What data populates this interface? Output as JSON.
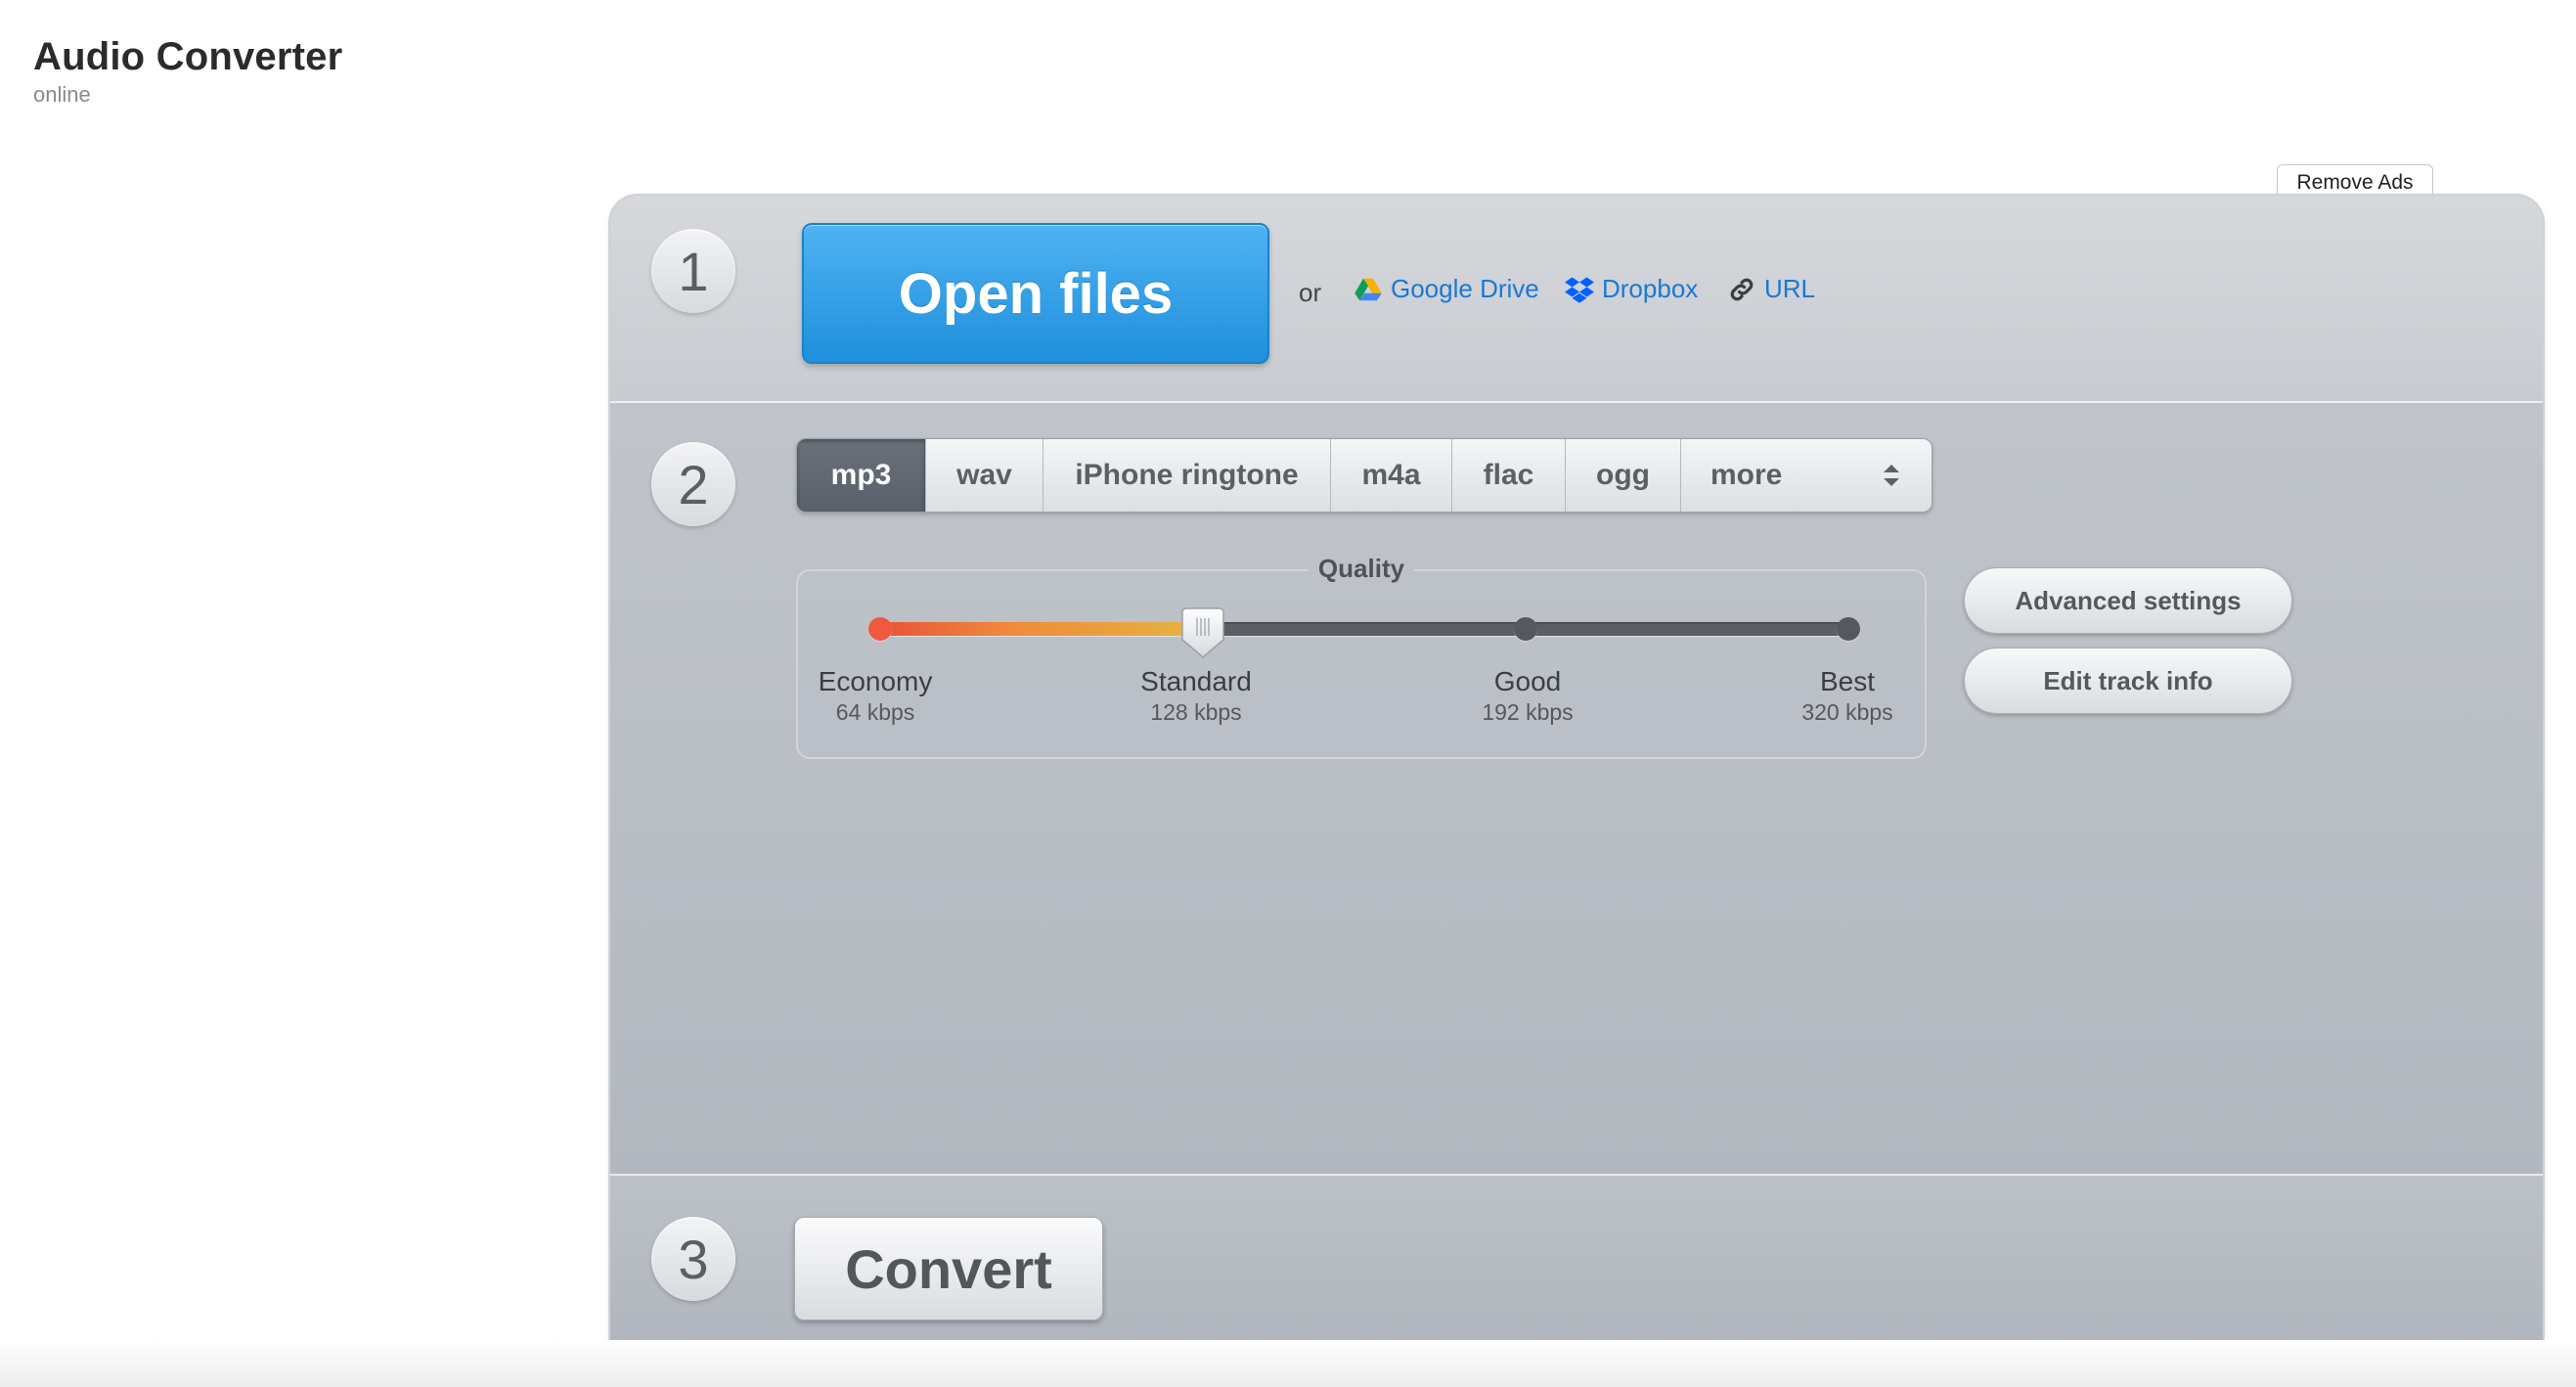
{
  "brand": {
    "title": "Audio Converter",
    "subtitle": "online"
  },
  "ads": {
    "remove_label": "Remove Ads"
  },
  "step1": {
    "number": "1",
    "open_label": "Open files",
    "or_label": "or",
    "sources": [
      {
        "label": "Google Drive",
        "icon": "google-drive-icon"
      },
      {
        "label": "Dropbox",
        "icon": "dropbox-icon"
      },
      {
        "label": "URL",
        "icon": "link-icon"
      }
    ]
  },
  "step2": {
    "number": "2",
    "formats": [
      "mp3",
      "wav",
      "iPhone ringtone",
      "m4a",
      "flac",
      "ogg",
      "more"
    ],
    "active_format": "mp3",
    "quality": {
      "title": "Quality",
      "selected_index": 1,
      "levels": [
        {
          "name": "Economy",
          "rate": "64 kbps"
        },
        {
          "name": "Standard",
          "rate": "128 kbps"
        },
        {
          "name": "Good",
          "rate": "192 kbps"
        },
        {
          "name": "Best",
          "rate": "320 kbps"
        }
      ]
    },
    "advanced_label": "Advanced settings",
    "edit_track_label": "Edit track info"
  },
  "step3": {
    "number": "3",
    "convert_label": "Convert"
  },
  "colors": {
    "accent_blue": "#1f8fdc",
    "link_blue": "#1a78d6",
    "active_tab": "#5f6770",
    "track_fill_start": "#e8533a",
    "track_fill_end": "#e6b440"
  }
}
